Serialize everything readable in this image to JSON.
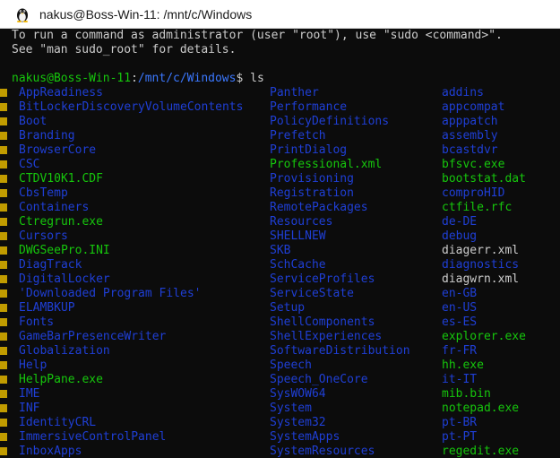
{
  "window": {
    "title": "nakus@Boss-Win-11: /mnt/c/Windows",
    "icon": "tux-icon"
  },
  "colors": {
    "background": "#0c0c0c",
    "directory": "#1f3fd6",
    "executable": "#16c60c",
    "plain_file": "#cccccc",
    "prompt_user": "#16c60c",
    "prompt_path": "#3b78ff"
  },
  "terminal": {
    "motd": [
      "To run a command as administrator (user \"root\"), use \"sudo <command>\".",
      "See \"man sudo_root\" for details."
    ],
    "prompt": {
      "user_host": "nakus@Boss-Win-11",
      "separator": ":",
      "path": "/mnt/c/Windows",
      "symbol": "$",
      "command": " ls"
    },
    "ls_rows": [
      [
        {
          "name": "AppReadiness",
          "type": "dir"
        },
        {
          "name": "Panther",
          "type": "dir"
        },
        {
          "name": "addins",
          "type": "dir"
        }
      ],
      [
        {
          "name": "BitLockerDiscoveryVolumeContents",
          "type": "dir"
        },
        {
          "name": "Performance",
          "type": "dir"
        },
        {
          "name": "appcompat",
          "type": "dir"
        }
      ],
      [
        {
          "name": "Boot",
          "type": "dir"
        },
        {
          "name": "PolicyDefinitions",
          "type": "dir"
        },
        {
          "name": "apppatch",
          "type": "dir"
        }
      ],
      [
        {
          "name": "Branding",
          "type": "dir"
        },
        {
          "name": "Prefetch",
          "type": "dir"
        },
        {
          "name": "assembly",
          "type": "dir"
        }
      ],
      [
        {
          "name": "BrowserCore",
          "type": "dir"
        },
        {
          "name": "PrintDialog",
          "type": "dir"
        },
        {
          "name": "bcastdvr",
          "type": "dir"
        }
      ],
      [
        {
          "name": "CSC",
          "type": "dir"
        },
        {
          "name": "Professional.xml",
          "type": "exe"
        },
        {
          "name": "bfsvc.exe",
          "type": "exe"
        }
      ],
      [
        {
          "name": "CTDV10K1.CDF",
          "type": "exe"
        },
        {
          "name": "Provisioning",
          "type": "dir"
        },
        {
          "name": "bootstat.dat",
          "type": "exe"
        }
      ],
      [
        {
          "name": "CbsTemp",
          "type": "dir"
        },
        {
          "name": "Registration",
          "type": "dir"
        },
        {
          "name": "comproHID",
          "type": "dir"
        }
      ],
      [
        {
          "name": "Containers",
          "type": "dir"
        },
        {
          "name": "RemotePackages",
          "type": "dir"
        },
        {
          "name": "ctfile.rfc",
          "type": "exe"
        }
      ],
      [
        {
          "name": "Ctregrun.exe",
          "type": "exe"
        },
        {
          "name": "Resources",
          "type": "dir"
        },
        {
          "name": "de-DE",
          "type": "dir"
        }
      ],
      [
        {
          "name": "Cursors",
          "type": "dir"
        },
        {
          "name": "SHELLNEW",
          "type": "dir"
        },
        {
          "name": "debug",
          "type": "dir"
        }
      ],
      [
        {
          "name": "DWGSeePro.INI",
          "type": "exe"
        },
        {
          "name": "SKB",
          "type": "dir"
        },
        {
          "name": "diagerr.xml",
          "type": "file"
        }
      ],
      [
        {
          "name": "DiagTrack",
          "type": "dir"
        },
        {
          "name": "SchCache",
          "type": "dir"
        },
        {
          "name": "diagnostics",
          "type": "dir"
        }
      ],
      [
        {
          "name": "DigitalLocker",
          "type": "dir"
        },
        {
          "name": "ServiceProfiles",
          "type": "dir"
        },
        {
          "name": "diagwrn.xml",
          "type": "file"
        }
      ],
      [
        {
          "name": "'Downloaded Program Files'",
          "type": "dir"
        },
        {
          "name": "ServiceState",
          "type": "dir"
        },
        {
          "name": "en-GB",
          "type": "dir"
        }
      ],
      [
        {
          "name": "ELAMBKUP",
          "type": "dir"
        },
        {
          "name": "Setup",
          "type": "dir"
        },
        {
          "name": "en-US",
          "type": "dir"
        }
      ],
      [
        {
          "name": "Fonts",
          "type": "dir"
        },
        {
          "name": "ShellComponents",
          "type": "dir"
        },
        {
          "name": "es-ES",
          "type": "dir"
        }
      ],
      [
        {
          "name": "GameBarPresenceWriter",
          "type": "dir"
        },
        {
          "name": "ShellExperiences",
          "type": "dir"
        },
        {
          "name": "explorer.exe",
          "type": "exe"
        }
      ],
      [
        {
          "name": "Globalization",
          "type": "dir"
        },
        {
          "name": "SoftwareDistribution",
          "type": "dir"
        },
        {
          "name": "fr-FR",
          "type": "dir"
        }
      ],
      [
        {
          "name": "Help",
          "type": "dir"
        },
        {
          "name": "Speech",
          "type": "dir"
        },
        {
          "name": "hh.exe",
          "type": "exe"
        }
      ],
      [
        {
          "name": "HelpPane.exe",
          "type": "exe"
        },
        {
          "name": "Speech_OneCore",
          "type": "dir"
        },
        {
          "name": "it-IT",
          "type": "dir"
        }
      ],
      [
        {
          "name": "IME",
          "type": "dir"
        },
        {
          "name": "SysWOW64",
          "type": "dir"
        },
        {
          "name": "mib.bin",
          "type": "exe"
        }
      ],
      [
        {
          "name": "INF",
          "type": "dir"
        },
        {
          "name": "System",
          "type": "dir"
        },
        {
          "name": "notepad.exe",
          "type": "exe"
        }
      ],
      [
        {
          "name": "IdentityCRL",
          "type": "dir"
        },
        {
          "name": "System32",
          "type": "dir"
        },
        {
          "name": "pt-BR",
          "type": "dir"
        }
      ],
      [
        {
          "name": "ImmersiveControlPanel",
          "type": "dir"
        },
        {
          "name": "SystemApps",
          "type": "dir"
        },
        {
          "name": "pt-PT",
          "type": "dir"
        }
      ],
      [
        {
          "name": "InboxApps",
          "type": "dir"
        },
        {
          "name": "SystemResources",
          "type": "dir"
        },
        {
          "name": "regedit.exe",
          "type": "exe"
        }
      ]
    ]
  }
}
